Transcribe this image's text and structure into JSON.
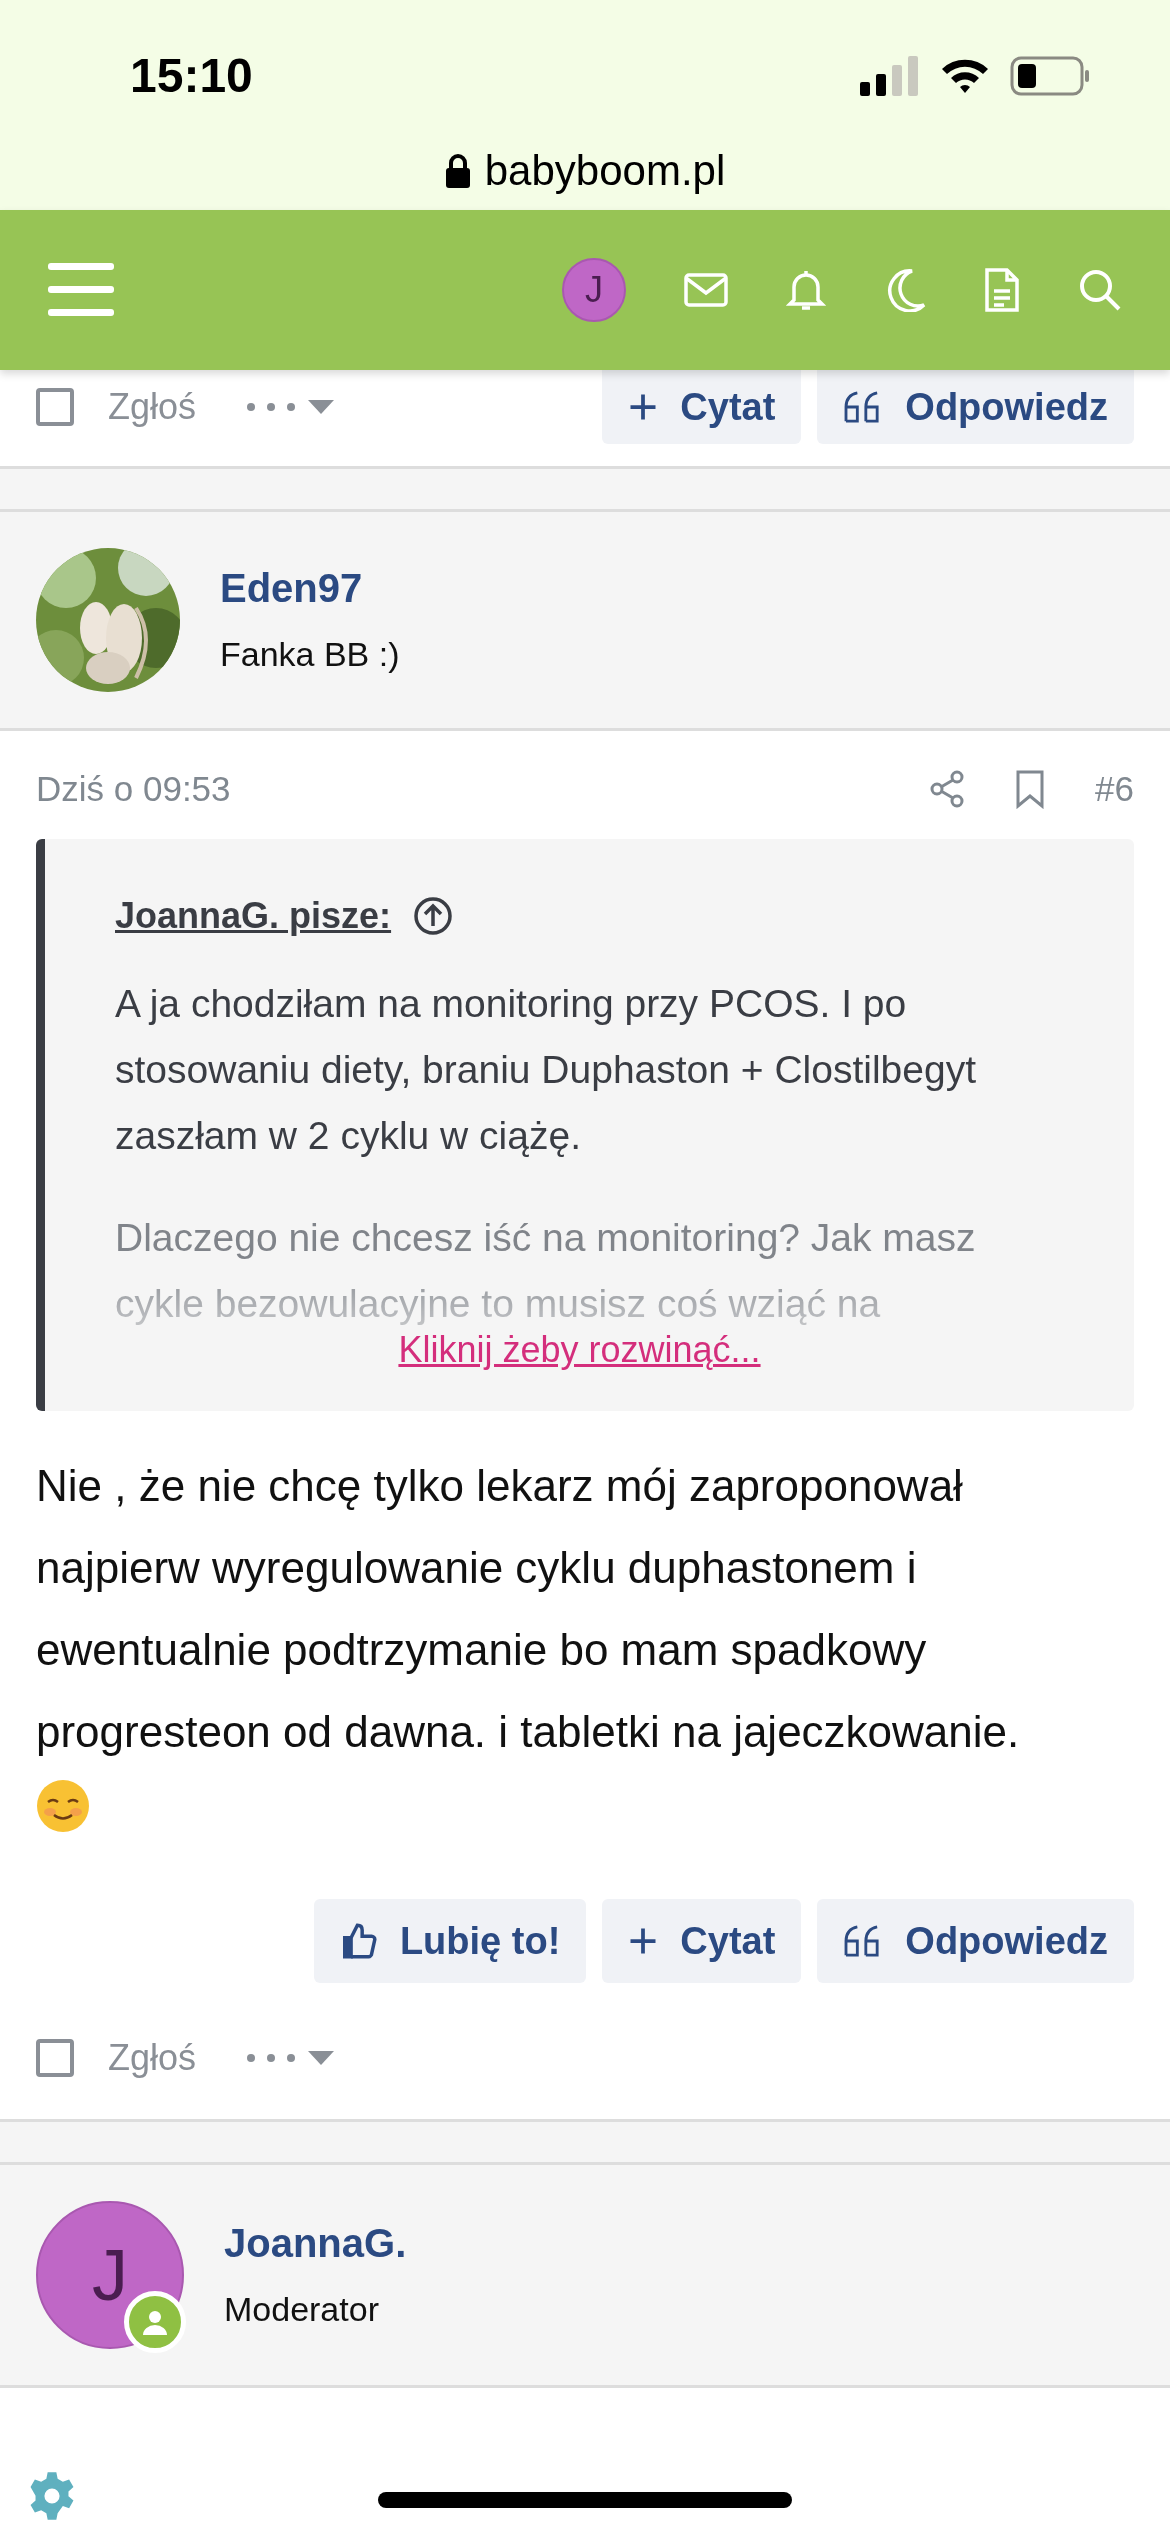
{
  "status_bar": {
    "time": "15:10"
  },
  "browser": {
    "url": "babyboom.pl"
  },
  "nav": {
    "avatar_letter": "J"
  },
  "prev_post_footer": {
    "checked": false,
    "report": "Zgłoś",
    "buttons": [
      {
        "kind": "quote",
        "label": "Cytat"
      },
      {
        "kind": "reply",
        "label": "Odpowiedz"
      }
    ]
  },
  "post": {
    "author": "Eden97",
    "role": "Fanka BB :)",
    "date": "Dziś o 09:53",
    "number": "#6",
    "quote": {
      "author": "JoannaG. pisze:",
      "paragraphs": [
        "A ja chodziłam na monitoring przy PCOS. I po stosowaniu diety, braniu Duphaston + Clostilbegyt zaszłam w 2 cyklu w ciążę.",
        "Dlaczego nie chcesz iść na monitoring? Jak masz cykle bezowulacyjne to musisz coś wziąć na"
      ],
      "expand": "Kliknij żeby rozwinąć..."
    },
    "body": "Nie , że nie chcę tylko lekarz mój zaproponował najpierw wyregulowanie cyklu duphastonem i ewentualnie podtrzymanie bo mam spadkowy progresteon od dawna. i tabletki na jajeczkowanie.",
    "buttons": [
      {
        "kind": "like",
        "label": "Lubię to!"
      },
      {
        "kind": "quote",
        "label": "Cytat"
      },
      {
        "kind": "reply",
        "label": "Odpowiedz"
      }
    ],
    "footer": {
      "checked": false,
      "report": "Zgłoś"
    }
  },
  "next_post": {
    "author": "JoannaG.",
    "role": "Moderator",
    "avatar_letter": "J"
  }
}
